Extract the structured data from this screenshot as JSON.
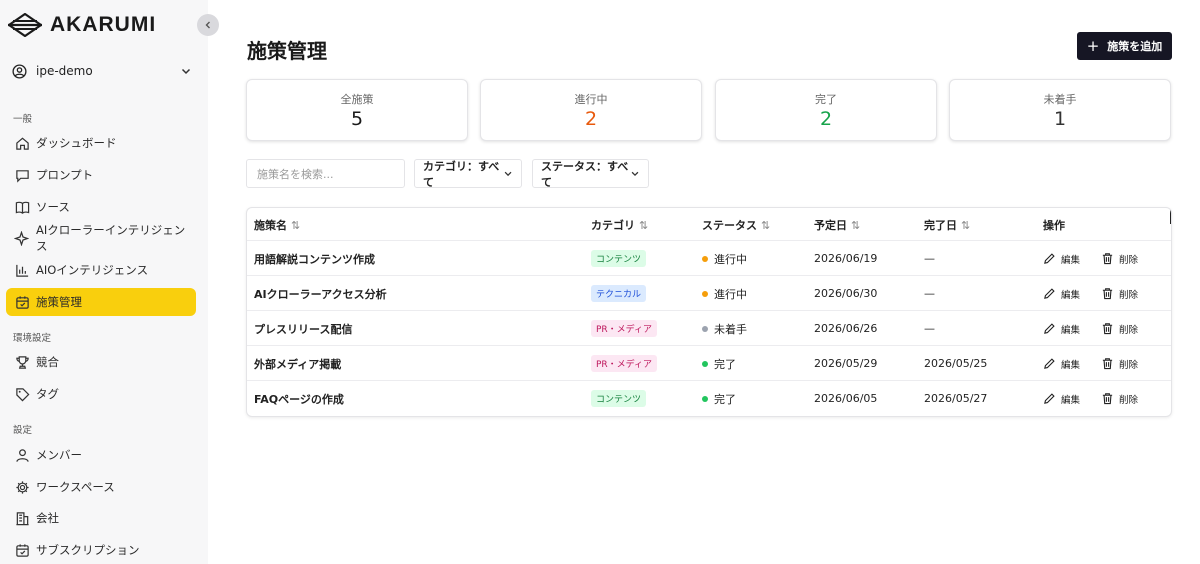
{
  "brand": {
    "name": "AKARUMI"
  },
  "workspace": {
    "name": "ipe-demo"
  },
  "sidebar": {
    "sections": [
      {
        "label": "一般",
        "items": [
          {
            "label": "ダッシュボード",
            "icon": "home-icon"
          },
          {
            "label": "プロンプト",
            "icon": "chat-icon"
          },
          {
            "label": "ソース",
            "icon": "book-icon"
          },
          {
            "label": "AIクローラーインテリジェンス",
            "icon": "sparkle-icon"
          },
          {
            "label": "AIOインテリジェンス",
            "icon": "bar-chart-icon"
          },
          {
            "label": "施策管理",
            "icon": "calendar-icon",
            "active": true
          }
        ]
      },
      {
        "label": "環境設定",
        "items": [
          {
            "label": "競合",
            "icon": "trophy-icon"
          },
          {
            "label": "タグ",
            "icon": "tag-icon"
          }
        ]
      },
      {
        "label": "設定",
        "items": [
          {
            "label": "メンバー",
            "icon": "user-icon"
          },
          {
            "label": "ワークスペース",
            "icon": "gear-icon"
          },
          {
            "label": "会社",
            "icon": "building-icon"
          },
          {
            "label": "サブスクリプション",
            "icon": "calendar-check-icon"
          }
        ]
      }
    ]
  },
  "page": {
    "title": "施策管理",
    "add_label": "施策を追加"
  },
  "stats": [
    {
      "label": "全施策",
      "value": "5",
      "color": "#1a1a1a"
    },
    {
      "label": "進行中",
      "value": "2",
      "color": "#e8590c"
    },
    {
      "label": "完了",
      "value": "2",
      "color": "#16a34a"
    },
    {
      "label": "未着手",
      "value": "1",
      "color": "#333333"
    }
  ],
  "filters": {
    "search_placeholder": "施策名を検索...",
    "category": "カテゴリ：すべて",
    "status": "ステータス：すべて"
  },
  "table": {
    "headers": {
      "name": "施策名",
      "category": "カテゴリ",
      "status": "ステータス",
      "due": "予定日",
      "done": "完了日",
      "actions": "操作"
    },
    "edit_label": "編集",
    "delete_label": "削除",
    "rows": [
      {
        "name": "用語解説コンテンツ作成",
        "category": "コンテンツ",
        "status": "進行中",
        "due": "2026/06/19",
        "done": "—"
      },
      {
        "name": "AIクローラーアクセス分析",
        "category": "テクニカル",
        "status": "進行中",
        "due": "2026/06/30",
        "done": "—"
      },
      {
        "name": "プレスリリース配信",
        "category": "PR・メディア",
        "status": "未着手",
        "due": "2026/06/26",
        "done": "—"
      },
      {
        "name": "外部メディア掲載",
        "category": "PR・メディア",
        "status": "完了",
        "due": "2026/05/29",
        "done": "2026/05/25"
      },
      {
        "name": "FAQページの作成",
        "category": "コンテンツ",
        "status": "完了",
        "due": "2026/06/05",
        "done": "2026/05/27"
      }
    ]
  },
  "colors": {
    "accent": "#f9cf0d",
    "primary_button": "#161624",
    "status_in_progress": "#f59e0b",
    "status_not_started": "#9ca3af",
    "status_done": "#22c55e",
    "tag_content_bg": "#dcfce7",
    "tag_content_fg": "#15803d",
    "tag_technical_bg": "#dbeafe",
    "tag_technical_fg": "#1d4ed8",
    "tag_pr_bg": "#fce7f3",
    "tag_pr_fg": "#be185d"
  }
}
